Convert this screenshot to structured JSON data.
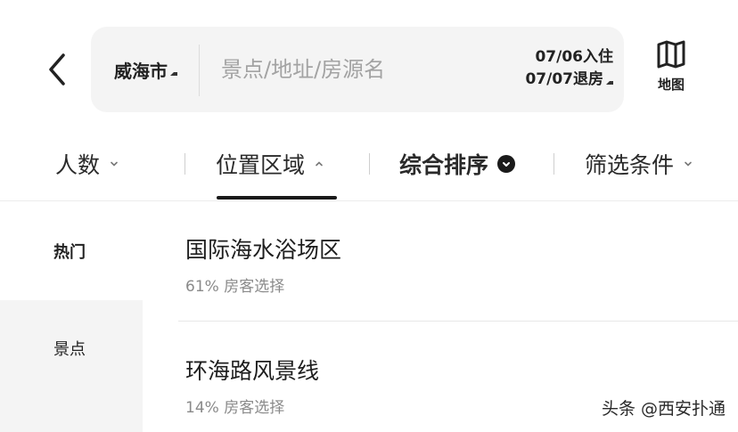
{
  "header": {
    "city": "威海市",
    "search_placeholder": "景点/地址/房源名",
    "checkin": "07/06入住",
    "checkout": "07/07退房",
    "map_label": "地图"
  },
  "filters": [
    {
      "label": "人数",
      "state": "collapsed"
    },
    {
      "label": "位置区域",
      "state": "active"
    },
    {
      "label": "综合排序",
      "state": "checked"
    },
    {
      "label": "筛选条件",
      "state": "collapsed"
    }
  ],
  "sidebar": {
    "items": [
      {
        "label": "热门"
      },
      {
        "label": "景点"
      }
    ]
  },
  "list": {
    "items": [
      {
        "name": "国际海水浴场区",
        "stat": "61% 房客选择"
      },
      {
        "name": "环海路风景线",
        "stat": "14% 房客选择"
      }
    ]
  },
  "watermark": "头条 @西安扑通",
  "colors": {
    "text": "#1a1a1a",
    "muted": "#8a8a8a",
    "panel": "#f4f4f4"
  }
}
